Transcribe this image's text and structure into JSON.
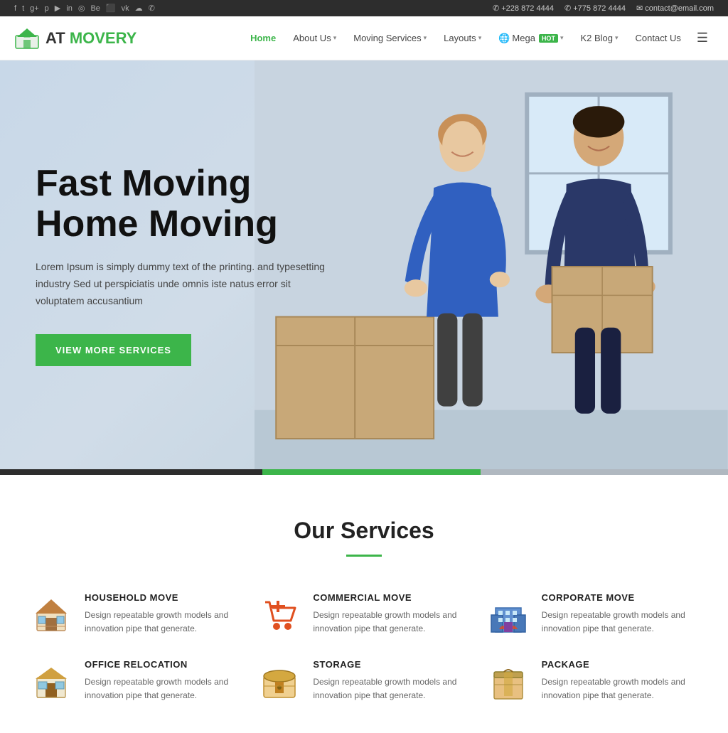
{
  "topbar": {
    "social_icons": [
      "f",
      "t",
      "g+",
      "p",
      "yt",
      "in",
      "inst",
      "be",
      "bb",
      "vk",
      "sk",
      "wh"
    ],
    "phone1": "+228 872 4444",
    "phone2": "+775 872 4444",
    "email": "contact@email.com"
  },
  "header": {
    "logo_text_at": "AT",
    "logo_text_name": " MOVERY",
    "nav": [
      {
        "label": "Home",
        "active": true,
        "has_dropdown": false
      },
      {
        "label": "About Us",
        "active": false,
        "has_dropdown": true
      },
      {
        "label": "Moving Services",
        "active": false,
        "has_dropdown": true
      },
      {
        "label": "Layouts",
        "active": false,
        "has_dropdown": true
      },
      {
        "label": "Mega",
        "active": false,
        "has_dropdown": true,
        "badge": "HOT"
      },
      {
        "label": "K2 Blog",
        "active": false,
        "has_dropdown": true
      },
      {
        "label": "Contact Us",
        "active": false,
        "has_dropdown": false
      }
    ]
  },
  "hero": {
    "title_line1": "Fast Moving",
    "title_line2": "Home Moving",
    "description": "Lorem Ipsum is simply dummy text of the printing. and typesetting industry Sed ut perspiciatis unde omnis iste natus error sit voluptatem accusantium",
    "button_label": "VIEW MORE SERVICES"
  },
  "services_section": {
    "title": "Our Services",
    "items": [
      {
        "name": "HOUSEHOLD MOVE",
        "description": "Design repeatable growth models and innovation pipe that generate.",
        "icon_type": "house"
      },
      {
        "name": "COMMERCIAL MOVE",
        "description": "Design repeatable growth models and innovation pipe that generate.",
        "icon_type": "cart"
      },
      {
        "name": "CORPORATE MOVE",
        "description": "Design repeatable growth models and innovation pipe that generate.",
        "icon_type": "building"
      },
      {
        "name": "OFFICE RELOCATION",
        "description": "Design repeatable growth models and innovation pipe that generate.",
        "icon_type": "office"
      },
      {
        "name": "STORAGE",
        "description": "Design repeatable growth models and innovation pipe that generate.",
        "icon_type": "storage"
      },
      {
        "name": "PACKAGE",
        "description": "Design repeatable growth models and innovation pipe that generate.",
        "icon_type": "package"
      }
    ]
  },
  "colors": {
    "green": "#3cb54a",
    "dark": "#2d2d2d",
    "light_bar": "#b0b8c0"
  }
}
